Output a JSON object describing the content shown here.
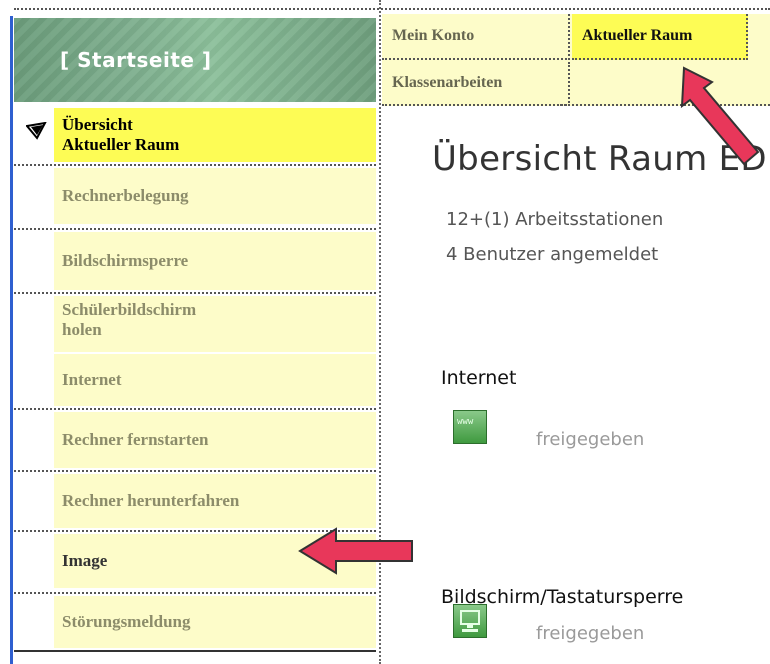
{
  "sidebar": {
    "home_label": "[ Startseite ]",
    "items": [
      {
        "label": "Übersicht\nAktueller Raum",
        "state": "active"
      },
      {
        "label": "Rechnerbelegung",
        "state": "normal"
      },
      {
        "label": "Bildschirmsperre",
        "state": "normal"
      },
      {
        "label": "Schülerbildschirm\nholen",
        "state": "normal"
      },
      {
        "label": "Internet",
        "state": "normal"
      },
      {
        "label": "Rechner fernstarten",
        "state": "normal"
      },
      {
        "label": "Rechner herunterfahren",
        "state": "normal"
      },
      {
        "label": "Image",
        "state": "highlight"
      },
      {
        "label": "Störungsmeldung",
        "state": "normal"
      }
    ]
  },
  "tabs": {
    "mein_konto": "Mein Konto",
    "aktueller_raum": "Aktueller Raum",
    "klassenarbeiten": "Klassenarbeiten"
  },
  "main": {
    "title": "Übersicht Raum ED",
    "workstations": "12+(1) Arbeitsstationen",
    "users": "4 Benutzer angemeldet",
    "internet": {
      "title": "Internet",
      "icon_text": "www",
      "status": "freigegeben"
    },
    "lock": {
      "title": "Bildschirm/Tastatursperre",
      "status": "freigegeben"
    }
  },
  "colors": {
    "nav_bg": "#fdfcc9",
    "nav_active": "#fdfc55",
    "home_green": "#7fb08f",
    "arrow": "#e8375a",
    "sidebar_blue": "#2f5fd0"
  }
}
